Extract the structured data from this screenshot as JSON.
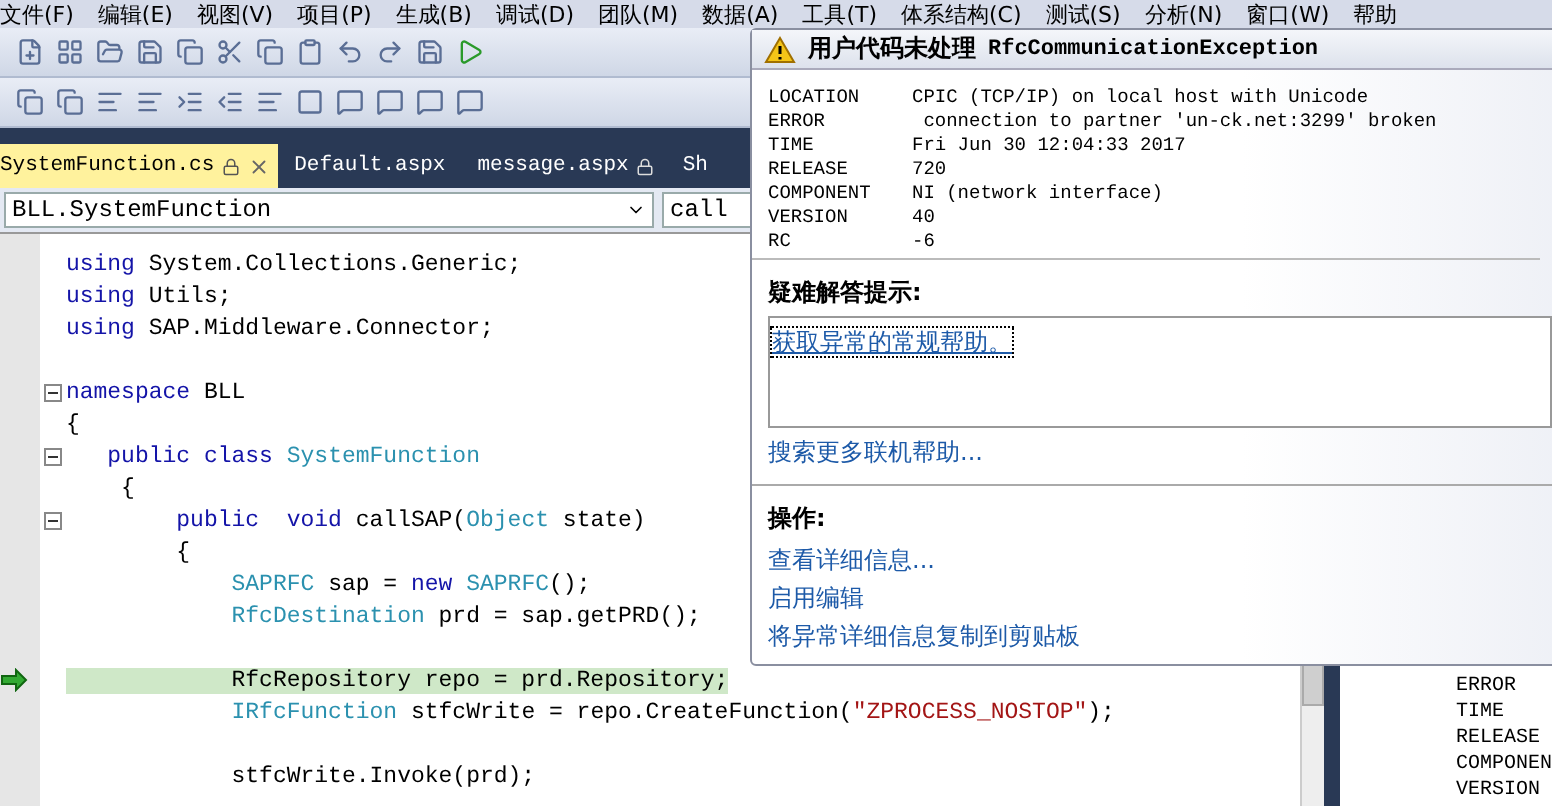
{
  "menu": [
    "文件(F)",
    "编辑(E)",
    "视图(V)",
    "项目(P)",
    "生成(B)",
    "调试(D)",
    "团队(M)",
    "数据(A)",
    "工具(T)",
    "体系结构(C)",
    "测试(S)",
    "分析(N)",
    "窗口(W)",
    "帮助"
  ],
  "tabs": [
    {
      "label": "SystemFunction.cs",
      "selected": true,
      "locked": true
    },
    {
      "label": "Default.aspx",
      "selected": false,
      "locked": false
    },
    {
      "label": "message.aspx",
      "selected": false,
      "locked": true
    },
    {
      "label": "Sh",
      "selected": false,
      "locked": false
    }
  ],
  "navigation": {
    "type_dropdown": "BLL.SystemFunction",
    "member_dropdown": "call"
  },
  "code": [
    {
      "kind": "code",
      "segments": [
        {
          "kind": "keyword",
          "text": "using"
        },
        {
          "kind": "plain",
          "text": " System.Collections.Generic;"
        }
      ]
    },
    {
      "kind": "code",
      "segments": [
        {
          "kind": "keyword",
          "text": "using"
        },
        {
          "kind": "plain",
          "text": " Utils;"
        }
      ]
    },
    {
      "kind": "code",
      "segments": [
        {
          "kind": "keyword",
          "text": "using"
        },
        {
          "kind": "plain",
          "text": " SAP.Middleware.Connector;"
        }
      ]
    },
    {
      "kind": "blank"
    },
    {
      "kind": "code",
      "foldable": true,
      "segments": [
        {
          "kind": "keyword",
          "text": "namespace"
        },
        {
          "kind": "plain",
          "text": " BLL"
        }
      ]
    },
    {
      "kind": "code",
      "segments": [
        {
          "kind": "plain",
          "text": "{"
        }
      ]
    },
    {
      "kind": "code",
      "foldable": true,
      "segments": [
        {
          "kind": "keyword",
          "text": "   public class"
        },
        {
          "kind": "type",
          "text": " SystemFunction"
        }
      ]
    },
    {
      "kind": "code",
      "segments": [
        {
          "kind": "plain",
          "text": "    {"
        }
      ]
    },
    {
      "kind": "code",
      "foldable": true,
      "segments": [
        {
          "kind": "keyword",
          "text": "        public  void"
        },
        {
          "kind": "plain",
          "text": " callSAP("
        },
        {
          "kind": "type",
          "text": "Object"
        },
        {
          "kind": "plain",
          "text": " state)"
        }
      ]
    },
    {
      "kind": "code",
      "segments": [
        {
          "kind": "plain",
          "text": "        {"
        }
      ]
    },
    {
      "kind": "code",
      "segments": [
        {
          "kind": "type",
          "text": "            SAPRFC"
        },
        {
          "kind": "plain",
          "text": " sap = "
        },
        {
          "kind": "keyword",
          "text": "new"
        },
        {
          "kind": "type",
          "text": " SAPRFC"
        },
        {
          "kind": "plain",
          "text": "();"
        }
      ]
    },
    {
      "kind": "code",
      "segments": [
        {
          "kind": "type",
          "text": "            RfcDestination"
        },
        {
          "kind": "plain",
          "text": " prd = sap.getPRD();"
        }
      ]
    },
    {
      "kind": "blank"
    },
    {
      "kind": "code",
      "current": true,
      "segments": [
        {
          "kind": "plain",
          "text": "            RfcRepository repo = prd.Repository;"
        }
      ]
    },
    {
      "kind": "code",
      "segments": [
        {
          "kind": "type",
          "text": "            IRfcFunction"
        },
        {
          "kind": "plain",
          "text": " stfcWrite = repo.CreateFunction("
        },
        {
          "kind": "string",
          "text": "\"ZPROCESS_NOSTOP\""
        },
        {
          "kind": "plain",
          "text": ");"
        }
      ]
    },
    {
      "kind": "blank"
    },
    {
      "kind": "code",
      "segments": [
        {
          "kind": "plain",
          "text": "            stfcWrite.Invoke(prd);"
        }
      ]
    }
  ],
  "side_panel": [
    "ERROR",
    "TIME",
    "RELEASE",
    "COMPONEN",
    "VERSION"
  ],
  "exception": {
    "title": "用户代码未处理",
    "exception_type": "RfcCommunicationException",
    "details": [
      {
        "key": "LOCATION",
        "value": "CPIC (TCP/IP) on local host with Unicode"
      },
      {
        "key": "ERROR",
        "value": " connection to partner 'un-ck.net:3299' broken"
      },
      {
        "key": "TIME",
        "value": "Fri Jun 30 12:04:33 2017"
      },
      {
        "key": "RELEASE",
        "value": "720"
      },
      {
        "key": "COMPONENT",
        "value": "NI (network interface)"
      },
      {
        "key": "VERSION",
        "value": "40"
      },
      {
        "key": "RC",
        "value": "-6"
      }
    ],
    "tips_heading": "疑难解答提示:",
    "tips": [
      {
        "label": "获取异常的常规帮助。",
        "focused": true
      }
    ],
    "search_link": "搜索更多联机帮助...",
    "actions_heading": "操作:",
    "actions": [
      "查看详细信息...",
      "启用编辑",
      "将异常详细信息复制到剪贴板"
    ]
  }
}
